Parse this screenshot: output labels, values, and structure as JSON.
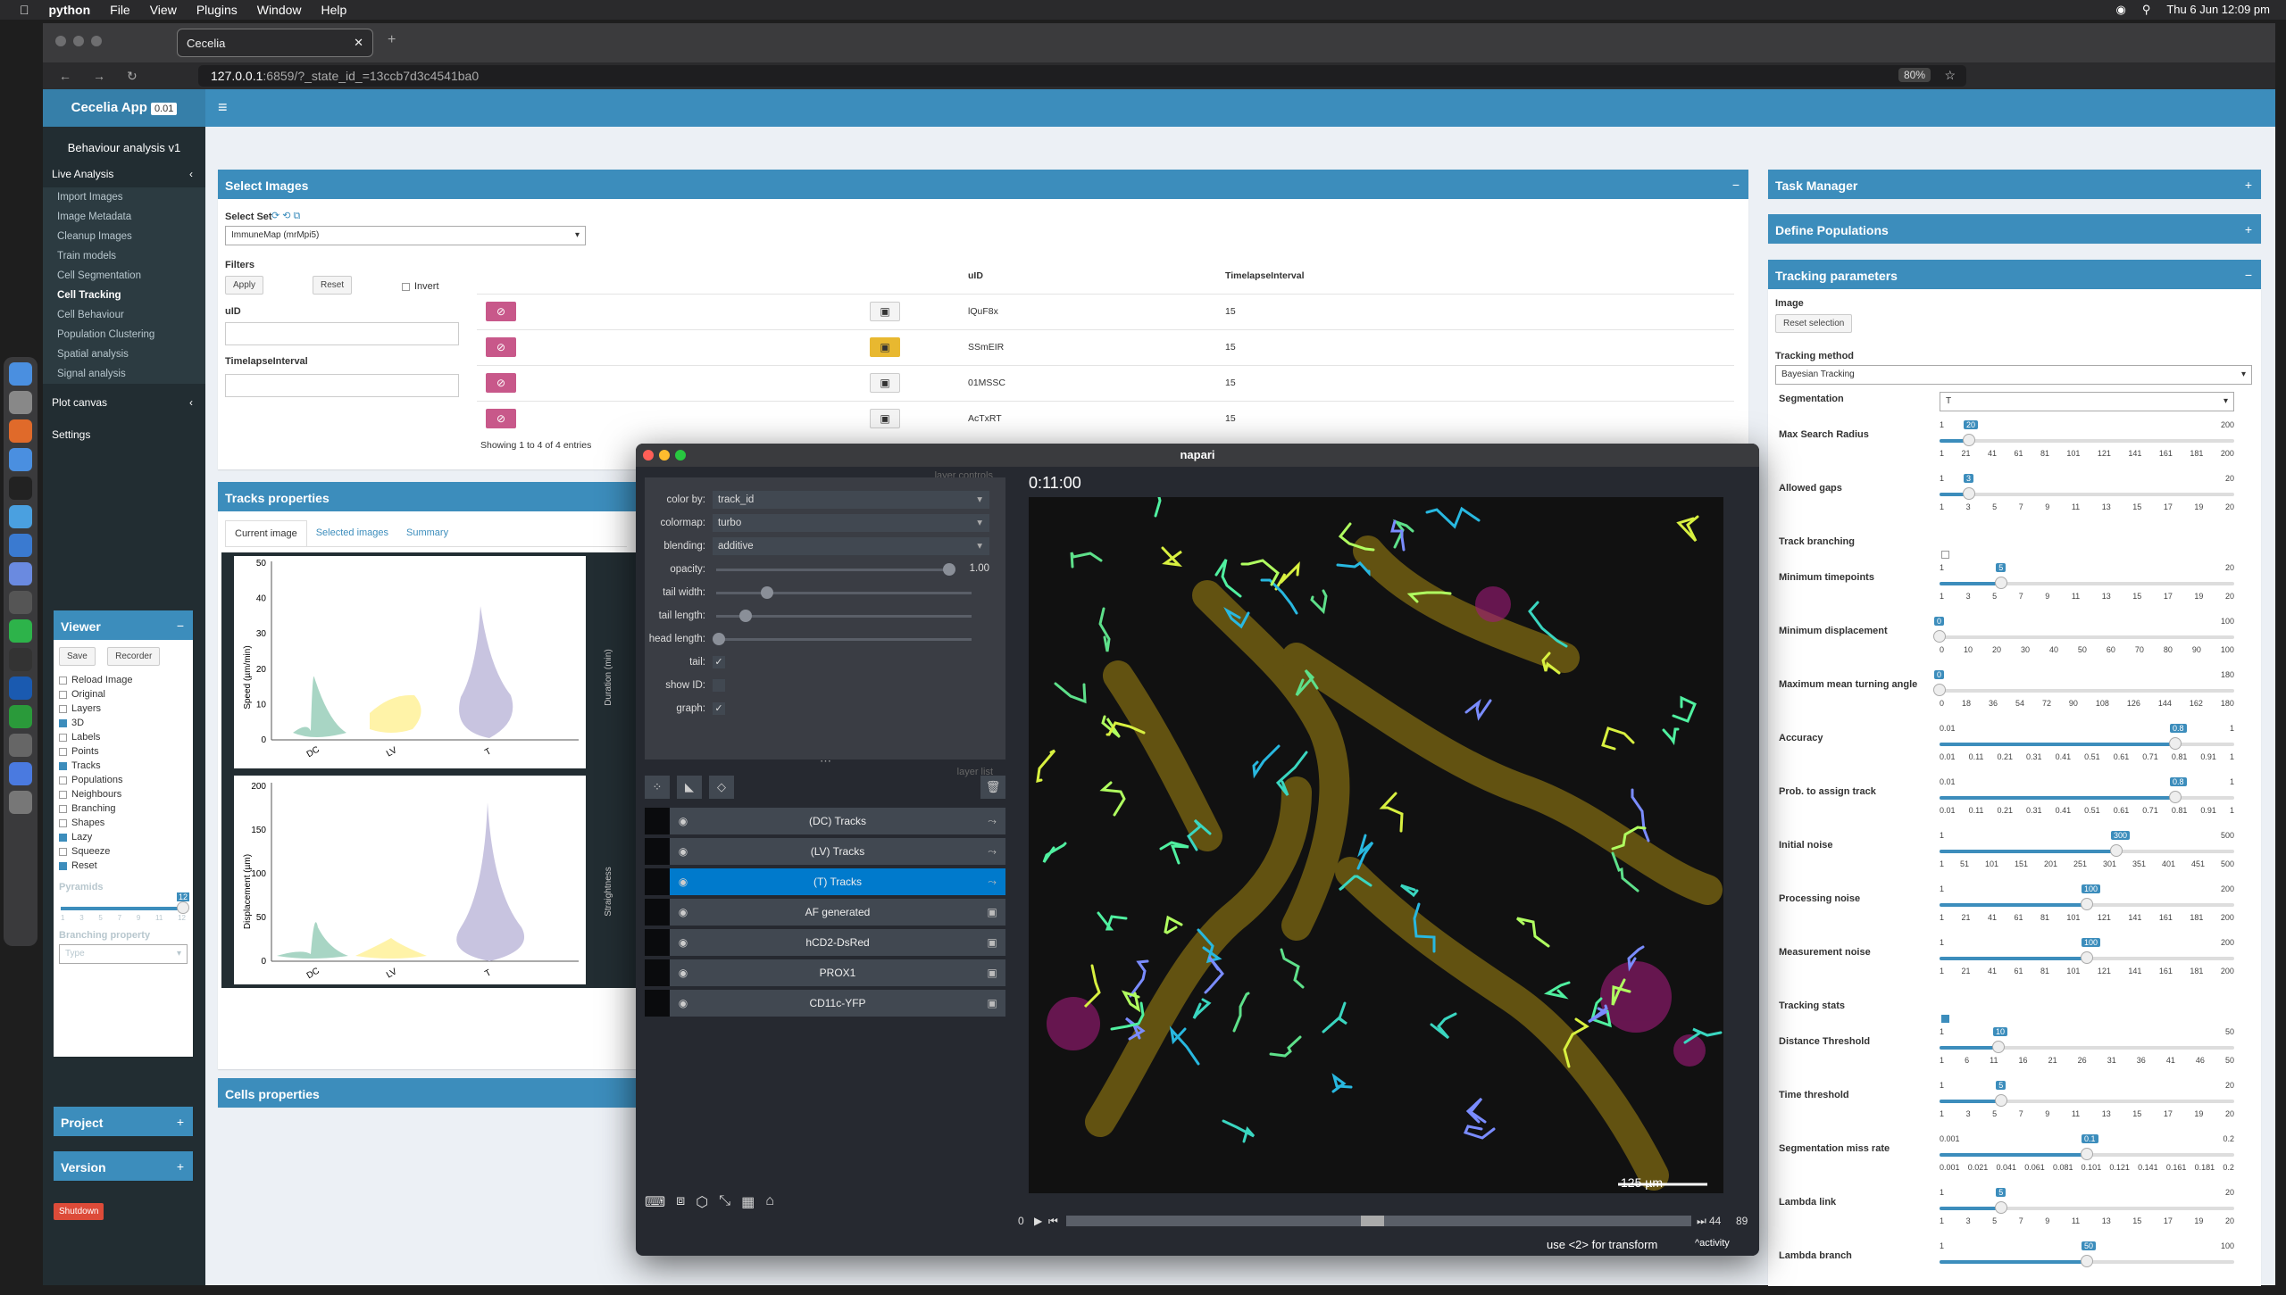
{
  "macos": {
    "app": "python",
    "menus": [
      "File",
      "View",
      "Plugins",
      "Window",
      "Help"
    ],
    "clock": "Thu 6 Jun  12:09 pm"
  },
  "browser": {
    "tab_title": "Cecelia",
    "url_host": "127.0.0.1",
    "url_rest": ":6859/?_state_id_=13ccb7d3c4541ba0",
    "zoom": "80%"
  },
  "app": {
    "brand": "Cecelia App",
    "version": "0.01",
    "module_title": "Behaviour analysis v1"
  },
  "sidebar": {
    "live_analysis": "Live Analysis",
    "items": [
      "Import Images",
      "Image Metadata",
      "Cleanup Images",
      "Train models",
      "Cell Segmentation",
      "Cell Tracking",
      "Cell Behaviour",
      "Population Clustering",
      "Spatial analysis",
      "Signal analysis"
    ],
    "active": "Cell Tracking",
    "plot_canvas": "Plot canvas",
    "settings": "Settings"
  },
  "viewer": {
    "title": "Viewer",
    "save": "Save",
    "recorder": "Recorder",
    "checks": [
      {
        "label": "Reload Image",
        "on": false
      },
      {
        "label": "Original",
        "on": false
      },
      {
        "label": "Layers",
        "on": false
      },
      {
        "label": "3D",
        "on": true
      },
      {
        "label": "Labels",
        "on": false
      },
      {
        "label": "Points",
        "on": false
      },
      {
        "label": "Tracks",
        "on": true
      },
      {
        "label": "Populations",
        "on": false
      },
      {
        "label": "Neighbours",
        "on": false
      },
      {
        "label": "Branching",
        "on": false
      },
      {
        "label": "Shapes",
        "on": false
      },
      {
        "label": "Lazy",
        "on": true
      },
      {
        "label": "Squeeze",
        "on": false
      },
      {
        "label": "Reset",
        "on": true
      }
    ],
    "pyramids_label": "Pyramids",
    "pyramids_value": "12",
    "pyramids_ticks": [
      "1",
      "3",
      "5",
      "7",
      "9",
      "11",
      "12"
    ],
    "branching_label": "Branching property",
    "branching_value": "Type"
  },
  "project": "Project",
  "version_box": "Version",
  "shutdown": "Shutdown",
  "select_images": {
    "title": "Select Images",
    "select_set": "Select Set",
    "set_value": "ImmuneMap (mrMpi5)",
    "filters": "Filters",
    "apply": "Apply",
    "reset": "Reset",
    "invert": "Invert",
    "uid_label": "uID",
    "ti_label": "TimelapseInterval",
    "col_uid": "uID",
    "col_ti": "TimelapseInterval",
    "rows": [
      {
        "uid": "lQuF8x",
        "ti": "15",
        "yellow": false
      },
      {
        "uid": "SSmEIR",
        "ti": "15",
        "yellow": true
      },
      {
        "uid": "01MSSC",
        "ti": "15",
        "yellow": false
      },
      {
        "uid": "AcTxRT",
        "ti": "15",
        "yellow": false
      }
    ],
    "showing": "Showing 1 to 4 of 4 entries"
  },
  "tracks_props": {
    "title": "Tracks properties",
    "tabs": [
      "Current image",
      "Selected images",
      "Summary"
    ],
    "plot1": {
      "ylabel": "Speed (µm/min)",
      "yticks": [
        "50",
        "40",
        "30",
        "20",
        "10",
        "0"
      ],
      "cats": [
        "DC",
        "LV",
        "T"
      ]
    },
    "plot2": {
      "ylabel": "Displacement (µm)",
      "yticks": [
        "200",
        "150",
        "100",
        "50",
        "0"
      ],
      "cats": [
        "DC",
        "LV",
        "T"
      ]
    },
    "side1": "Duration (min)",
    "side2": "Straightness"
  },
  "cells_props": {
    "title": "Cells properties"
  },
  "right": {
    "task_manager": "Task Manager",
    "define_pops": "Define Populations",
    "tracking_params": "Tracking parameters",
    "image_label": "Image",
    "reset_selection": "Reset selection",
    "method_label": "Tracking method",
    "method_value": "Bayesian Tracking",
    "segmentation_label": "Segmentation",
    "segmentation_value": "T",
    "track_branching": "Track branching",
    "tracking_stats": "Tracking stats"
  },
  "params": [
    {
      "label": "Max Search Radius",
      "min": "1",
      "max": "200",
      "val": "20",
      "frac": 0.1,
      "ticks": [
        "1",
        "21",
        "41",
        "61",
        "81",
        "101",
        "121",
        "141",
        "161",
        "181",
        "200"
      ]
    },
    {
      "label": "Allowed gaps",
      "min": "1",
      "max": "20",
      "val": "3",
      "frac": 0.1,
      "ticks": [
        "1",
        "3",
        "5",
        "7",
        "9",
        "11",
        "13",
        "15",
        "17",
        "19",
        "20"
      ]
    },
    {
      "label": "Minimum timepoints",
      "min": "1",
      "max": "20",
      "val": "5",
      "frac": 0.21,
      "ticks": [
        "1",
        "3",
        "5",
        "7",
        "9",
        "11",
        "13",
        "15",
        "17",
        "19",
        "20"
      ]
    },
    {
      "label": "Minimum displacement",
      "min": "0",
      "max": "100",
      "val": "0",
      "frac": 0,
      "ticks": [
        "0",
        "10",
        "20",
        "30",
        "40",
        "50",
        "60",
        "70",
        "80",
        "90",
        "100"
      ]
    },
    {
      "label": "Maximum mean turning angle",
      "min": "0",
      "max": "180",
      "val": "0",
      "frac": 0,
      "ticks": [
        "0",
        "18",
        "36",
        "54",
        "72",
        "90",
        "108",
        "126",
        "144",
        "162",
        "180"
      ]
    },
    {
      "label": "Accuracy",
      "min": "0.01",
      "max": "1",
      "val": "0.8",
      "frac": 0.8,
      "ticks": [
        "0.01",
        "0.11",
        "0.21",
        "0.31",
        "0.41",
        "0.51",
        "0.61",
        "0.71",
        "0.81",
        "0.91",
        "1"
      ]
    },
    {
      "label": "Prob. to assign track",
      "min": "0.01",
      "max": "1",
      "val": "0.8",
      "frac": 0.8,
      "ticks": [
        "0.01",
        "0.11",
        "0.21",
        "0.31",
        "0.41",
        "0.51",
        "0.61",
        "0.71",
        "0.81",
        "0.91",
        "1"
      ]
    },
    {
      "label": "Initial noise",
      "min": "1",
      "max": "500",
      "val": "300",
      "frac": 0.6,
      "ticks": [
        "1",
        "51",
        "101",
        "151",
        "201",
        "251",
        "301",
        "351",
        "401",
        "451",
        "500"
      ]
    },
    {
      "label": "Processing noise",
      "min": "1",
      "max": "200",
      "val": "100",
      "frac": 0.5,
      "ticks": [
        "1",
        "21",
        "41",
        "61",
        "81",
        "101",
        "121",
        "141",
        "161",
        "181",
        "200"
      ]
    },
    {
      "label": "Measurement noise",
      "min": "1",
      "max": "200",
      "val": "100",
      "frac": 0.5,
      "ticks": [
        "1",
        "21",
        "41",
        "61",
        "81",
        "101",
        "121",
        "141",
        "161",
        "181",
        "200"
      ]
    },
    {
      "label": "Distance Threshold",
      "min": "1",
      "max": "50",
      "val": "10",
      "frac": 0.2,
      "ticks": [
        "1",
        "6",
        "11",
        "16",
        "21",
        "26",
        "31",
        "36",
        "41",
        "46",
        "50"
      ]
    },
    {
      "label": "Time threshold",
      "min": "1",
      "max": "20",
      "val": "5",
      "frac": 0.21,
      "ticks": [
        "1",
        "3",
        "5",
        "7",
        "9",
        "11",
        "13",
        "15",
        "17",
        "19",
        "20"
      ]
    },
    {
      "label": "Segmentation miss rate",
      "min": "0.001",
      "max": "0.2",
      "val": "0.1",
      "frac": 0.5,
      "ticks": [
        "0.001",
        "0.021",
        "0.041",
        "0.061",
        "0.081",
        "0.101",
        "0.121",
        "0.141",
        "0.161",
        "0.181",
        "0.2"
      ]
    },
    {
      "label": "Lambda link",
      "min": "1",
      "max": "20",
      "val": "5",
      "frac": 0.21,
      "ticks": [
        "1",
        "3",
        "5",
        "7",
        "9",
        "11",
        "13",
        "15",
        "17",
        "19",
        "20"
      ]
    },
    {
      "label": "Lambda branch",
      "min": "1",
      "max": "100",
      "val": "50",
      "frac": 0.5,
      "ticks": []
    }
  ],
  "napari": {
    "title": "napari",
    "layer_controls": "layer controls",
    "layer_list": "layer list",
    "color_by_label": "color by:",
    "color_by": "track_id",
    "colormap_label": "colormap:",
    "colormap": "turbo",
    "blending_label": "blending:",
    "blending": "additive",
    "opacity_label": "opacity:",
    "opacity": "1.00",
    "tail_width_label": "tail width:",
    "tail_length_label": "tail length:",
    "head_length_label": "head length:",
    "tail_label": "tail:",
    "show_id_label": "show ID:",
    "graph_label": "graph:",
    "layers": [
      "(DC) Tracks",
      "(LV) Tracks",
      "(T) Tracks",
      "AF generated",
      "hCD2-DsRed",
      "PROX1",
      "CD11c-YFP"
    ],
    "selected_layer": "(T) Tracks",
    "time": "0:11:00",
    "scale": "125 µm",
    "frame_start": "0",
    "frame_cur": "44",
    "frame_max": "89",
    "status": "use <2> for transform",
    "activity": "activity"
  }
}
